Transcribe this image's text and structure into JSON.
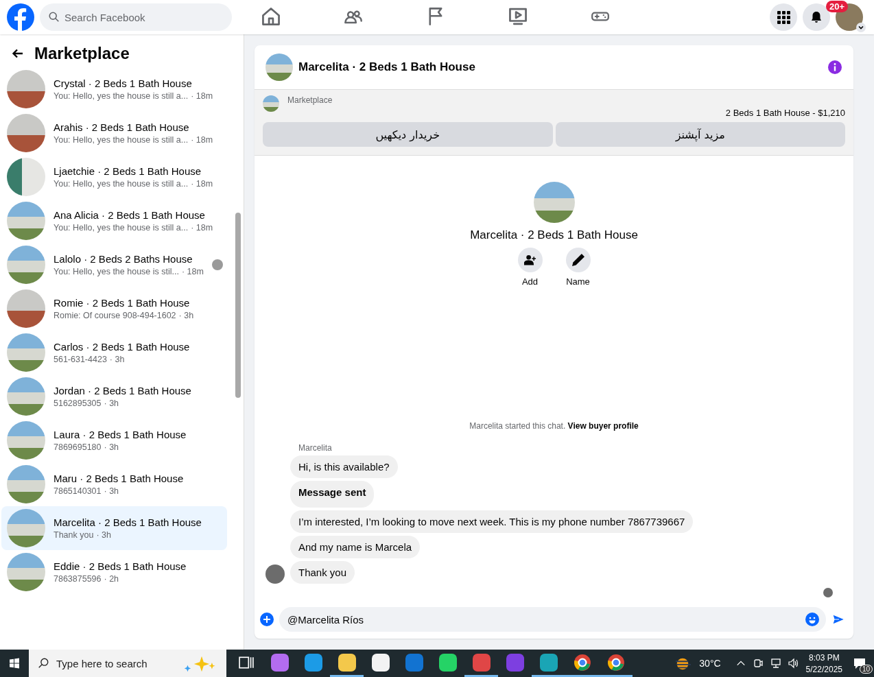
{
  "topbar": {
    "search_placeholder": "Search Facebook",
    "nav": [
      {
        "selected": false
      },
      {
        "selected": false
      },
      {
        "selected": false
      },
      {
        "selected": false
      },
      {
        "selected": false
      }
    ],
    "notification_badge": "20+"
  },
  "sidebar": {
    "title": "Marketplace",
    "conversations": [
      {
        "name": "Crystal · 2 Beds 1 Bath House",
        "preview": "You: Hello, yes the house is still a...",
        "time": "· 18m",
        "selected": false,
        "seen": false
      },
      {
        "name": "Arahis · 2 Beds 1 Bath House",
        "preview": "You: Hello, yes the house is still a...",
        "time": "· 18m",
        "selected": false,
        "seen": false
      },
      {
        "name": "Ljaetchie · 2 Beds 1 Bath House",
        "preview": "You: Hello, yes the house is still a...",
        "time": "· 18m",
        "selected": false,
        "seen": false
      },
      {
        "name": "Ana Alicia · 2 Beds 1 Bath House",
        "preview": "You: Hello, yes the house is still a...",
        "time": "· 18m",
        "selected": false,
        "seen": false
      },
      {
        "name": "Lalolo · 2 Beds 2 Baths House",
        "preview": "You: Hello, yes the house is stil...",
        "time": "· 18m",
        "selected": false,
        "seen": true
      },
      {
        "name": "Romie · 2 Beds 1 Bath House",
        "preview": "Romie: Of course 908-494-1602",
        "time": "· 3h",
        "selected": false,
        "seen": false
      },
      {
        "name": "Carlos · 2 Beds 1 Bath House",
        "preview": "561-631-4423",
        "time": "· 3h",
        "selected": false,
        "seen": false
      },
      {
        "name": "Jordan · 2 Beds 1 Bath House",
        "preview": "5162895305",
        "time": "· 3h",
        "selected": false,
        "seen": false
      },
      {
        "name": "Laura · 2 Beds 1 Bath House",
        "preview": "7869695180",
        "time": "· 3h",
        "selected": false,
        "seen": false
      },
      {
        "name": "Maru · 2 Beds 1 Bath House",
        "preview": "7865140301",
        "time": "· 3h",
        "selected": false,
        "seen": false
      },
      {
        "name": "Marcelita · 2 Beds 1 Bath House",
        "preview": "Thank you",
        "time": "· 3h",
        "selected": true,
        "seen": false
      },
      {
        "name": "Eddie · 2 Beds 1 Bath House",
        "preview": "7863875596",
        "time": "· 2h",
        "selected": false,
        "seen": false
      }
    ]
  },
  "chat": {
    "title": "Marcelita · 2 Beds 1 Bath House",
    "listing": {
      "source": "Marketplace",
      "summary": "2 Beds 1 Bath House - $1,210",
      "buttons": [
        "مزید آپشنز",
        "خریدار دیکھیں"
      ]
    },
    "profile": {
      "name": "Marcelita · 2 Beds 1 Bath House",
      "actions": [
        "Add",
        "Name"
      ]
    },
    "started_notice": {
      "text": "Marcelita started this chat.",
      "link": "View buyer profile"
    },
    "sender": "Marcelita",
    "messages": [
      {
        "text": "Hi, is this available?",
        "kind": "normal"
      },
      {
        "text": "Message sent",
        "kind": "bold"
      },
      {
        "text": "I’m interested, I’m looking to move next week. This is my phone number 7867739667",
        "kind": "normal"
      },
      {
        "text": "And my name is Marcela",
        "kind": "normal"
      },
      {
        "text": "Thank you",
        "kind": "normal"
      }
    ],
    "composer_value": "@Marcelita Ríos"
  },
  "taskbar": {
    "search_placeholder": "Type here to search",
    "apps": [
      {
        "active": false
      },
      {
        "active": false
      },
      {
        "active": false
      },
      {
        "active": true
      },
      {
        "active": false
      },
      {
        "active": false
      },
      {
        "active": false
      },
      {
        "active": true
      },
      {
        "active": false
      },
      {
        "active": true
      },
      {
        "active": true
      },
      {
        "active": true
      }
    ],
    "weather": "30°C",
    "time": "8:03 PM",
    "date": "5/22/2025",
    "notifications": "10"
  }
}
